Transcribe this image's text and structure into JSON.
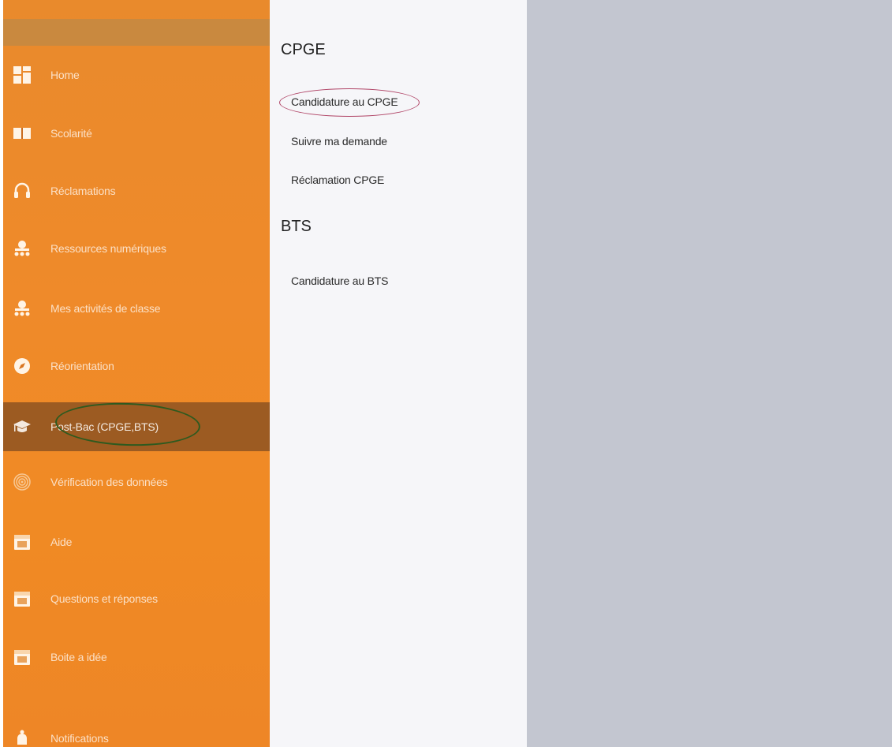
{
  "sidebar": {
    "items": [
      {
        "label": "Home",
        "icon": "grid-icon"
      },
      {
        "label": "Scolarité",
        "icon": "book-icon"
      },
      {
        "label": "Réclamations",
        "icon": "headset-icon"
      },
      {
        "label": "Ressources numériques",
        "icon": "network-icon"
      },
      {
        "label": "Mes activités de classe",
        "icon": "network-icon"
      },
      {
        "label": "Réorientation",
        "icon": "compass-icon"
      },
      {
        "label": "Post-Bac (CPGE,BTS)",
        "icon": "graduation-cap-icon",
        "active": true
      },
      {
        "label": "Vérification des données",
        "icon": "fingerprint-icon"
      },
      {
        "label": "Aide",
        "icon": "calendar-icon"
      },
      {
        "label": "Questions et réponses",
        "icon": "calendar-icon"
      },
      {
        "label": "Boite a idée",
        "icon": "calendar-icon"
      },
      {
        "label": "Notifications",
        "icon": "bell-icon"
      }
    ]
  },
  "submenu": {
    "cpge": {
      "heading": "CPGE",
      "links": [
        "Candidature au CPGE",
        "Suivre ma demande",
        "Réclamation CPGE"
      ]
    },
    "bts": {
      "heading": "BTS",
      "links": [
        "Candidature au BTS"
      ]
    }
  },
  "colors": {
    "sidebar": "#ee8a2a",
    "active_item": "#9c5b22",
    "submenu_bg": "#f6f6f9",
    "content_bg": "#c3c6d0"
  }
}
